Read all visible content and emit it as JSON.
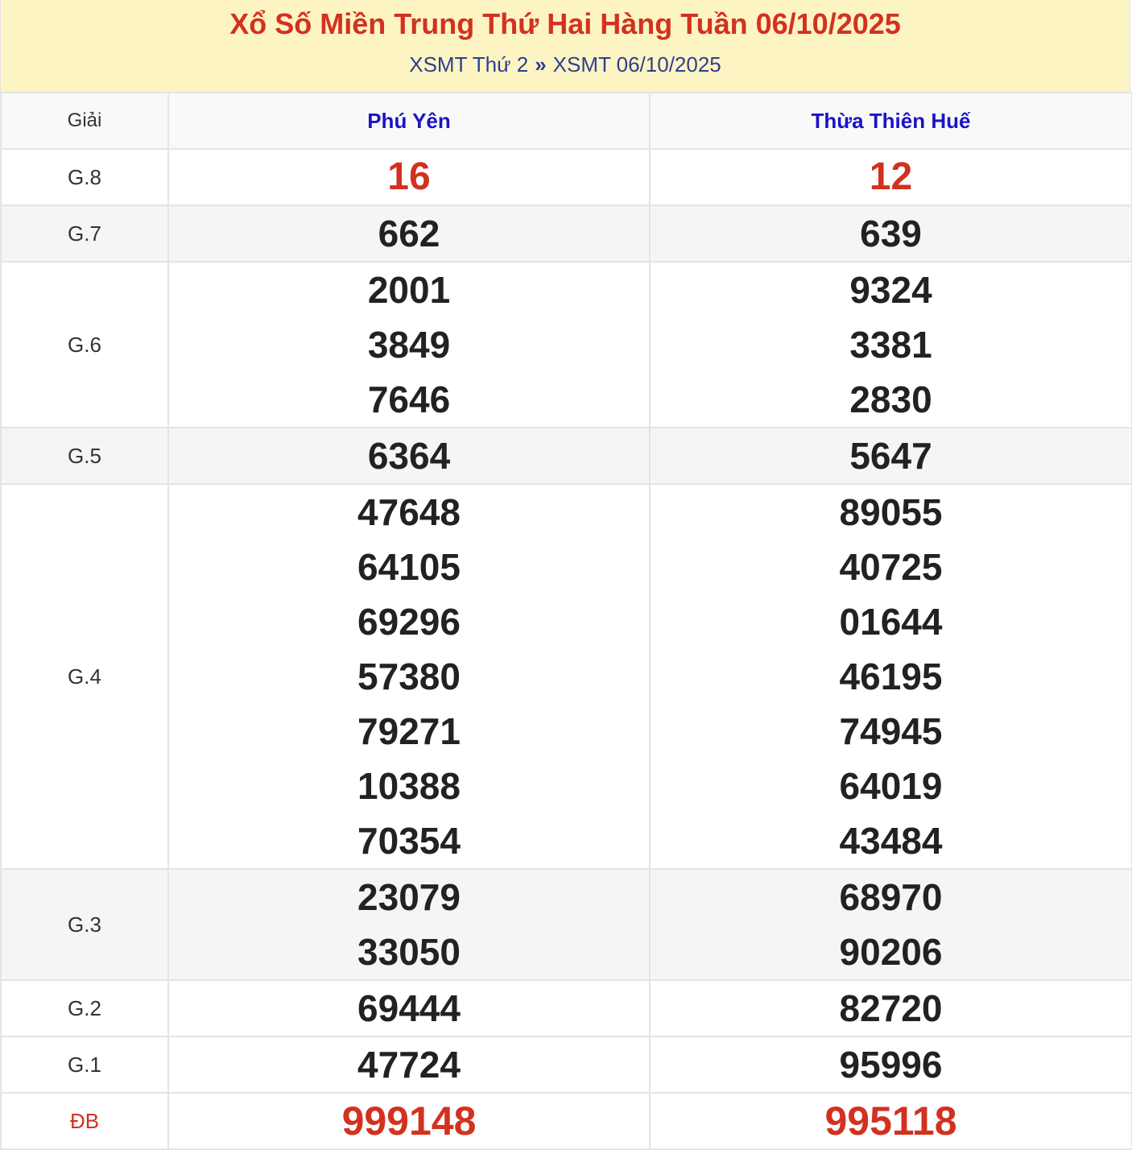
{
  "header": {
    "title": "Xổ Số Miền Trung Thứ Hai Hàng Tuần 06/10/2025",
    "breadcrumb_1": "XSMT Thứ 2",
    "separator": "»",
    "breadcrumb_2": "XSMT 06/10/2025"
  },
  "table": {
    "col_label": "Giải",
    "provinces": [
      "Phú Yên",
      "Thừa Thiên Huế"
    ],
    "prizes": {
      "g8": {
        "label": "G.8",
        "p1": [
          "16"
        ],
        "p2": [
          "12"
        ]
      },
      "g7": {
        "label": "G.7",
        "p1": [
          "662"
        ],
        "p2": [
          "639"
        ]
      },
      "g6": {
        "label": "G.6",
        "p1": [
          "2001",
          "3849",
          "7646"
        ],
        "p2": [
          "9324",
          "3381",
          "2830"
        ]
      },
      "g5": {
        "label": "G.5",
        "p1": [
          "6364"
        ],
        "p2": [
          "5647"
        ]
      },
      "g4": {
        "label": "G.4",
        "p1": [
          "47648",
          "64105",
          "69296",
          "57380",
          "79271",
          "10388",
          "70354"
        ],
        "p2": [
          "89055",
          "40725",
          "01644",
          "46195",
          "74945",
          "64019",
          "43484"
        ]
      },
      "g3": {
        "label": "G.3",
        "p1": [
          "23079",
          "33050"
        ],
        "p2": [
          "68970",
          "90206"
        ]
      },
      "g2": {
        "label": "G.2",
        "p1": [
          "69444"
        ],
        "p2": [
          "82720"
        ]
      },
      "g1": {
        "label": "G.1",
        "p1": [
          "47724"
        ],
        "p2": [
          "95996"
        ]
      },
      "db": {
        "label": "ĐB",
        "p1": [
          "999148"
        ],
        "p2": [
          "995118"
        ]
      }
    }
  },
  "colors": {
    "title": "#d3311f",
    "province": "#1a14c8",
    "header_bg": "#fdf4c4",
    "link": "#2e3f8f"
  }
}
